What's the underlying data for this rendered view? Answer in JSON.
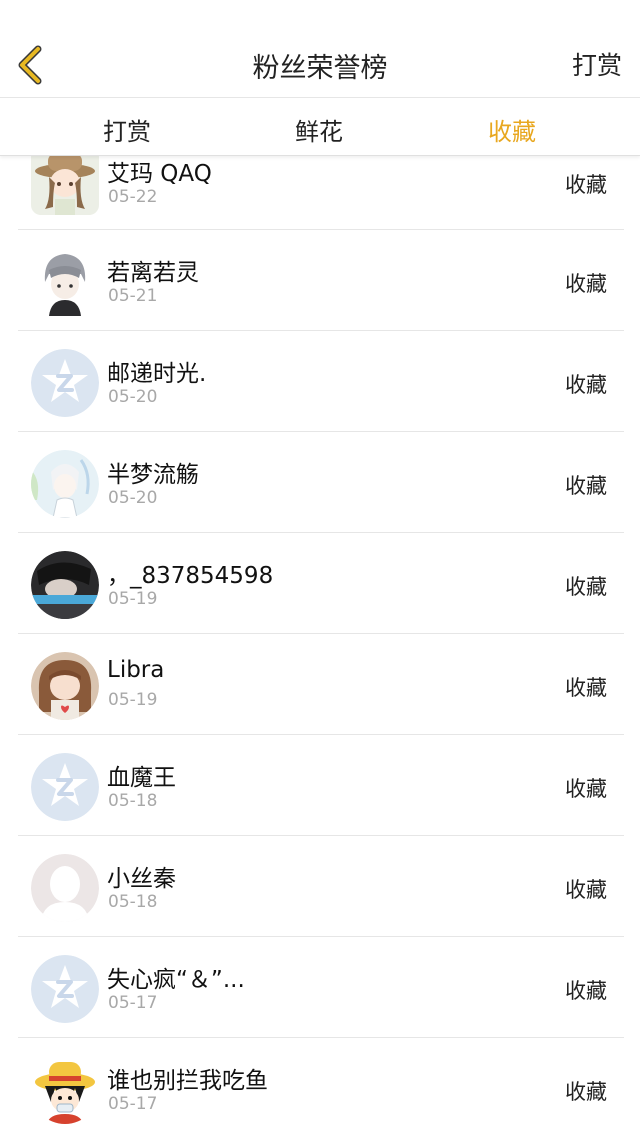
{
  "header": {
    "title": "粉丝荣誉榜",
    "action_label": "打赏"
  },
  "tabs": [
    {
      "label": "打赏",
      "active": false
    },
    {
      "label": "鲜花",
      "active": false
    },
    {
      "label": "收藏",
      "active": true
    }
  ],
  "colors": {
    "accent": "#e8a71f",
    "back_icon": "#e8b923"
  },
  "fans": [
    {
      "name": "艾玛 QAQ",
      "date": "05-22",
      "action": "收藏",
      "avatar": "anime-girl-hat"
    },
    {
      "name": "若离若灵",
      "date": "05-21",
      "action": "收藏",
      "avatar": "anime-boy-grey-hair"
    },
    {
      "name": "邮递时光.",
      "date": "05-20",
      "action": "收藏",
      "avatar": "default-star"
    },
    {
      "name": "半梦流觞",
      "date": "05-20",
      "action": "收藏",
      "avatar": "anime-white-hair"
    },
    {
      "name": "，_837854598",
      "date": "05-19",
      "action": "收藏",
      "avatar": "photo-dark-face"
    },
    {
      "name": "Libra",
      "date": "05-19",
      "action": "收藏",
      "avatar": "anime-girl-heart"
    },
    {
      "name": "血魔王",
      "date": "05-18",
      "action": "收藏",
      "avatar": "default-star"
    },
    {
      "name": "小丝秦",
      "date": "05-18",
      "action": "收藏",
      "avatar": "blank-silhouette"
    },
    {
      "name": "失心疯“＆”...",
      "date": "05-17",
      "action": "收藏",
      "avatar": "default-star"
    },
    {
      "name": "谁也别拦我吃鱼",
      "date": "05-17",
      "action": "收藏",
      "avatar": "anime-straw-hat"
    }
  ]
}
